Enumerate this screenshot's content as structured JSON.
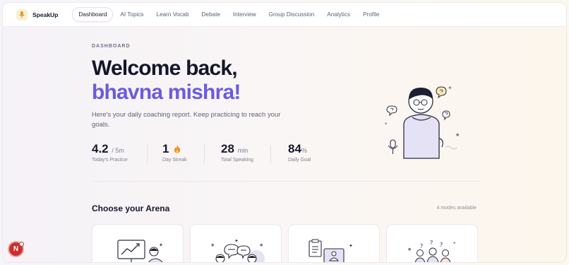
{
  "app": {
    "name": "SpeakUp",
    "accent": "#6a5be2"
  },
  "nav": {
    "items": [
      {
        "label": "Dashboard",
        "active": true
      },
      {
        "label": "AI Topics"
      },
      {
        "label": "Learn Vocab"
      },
      {
        "label": "Debate"
      },
      {
        "label": "Interview"
      },
      {
        "label": "Group Discussion"
      },
      {
        "label": "Analytics"
      },
      {
        "label": "Profile"
      }
    ]
  },
  "hero": {
    "eyebrow": "DASHBOARD",
    "greeting": "Welcome back,",
    "username": "bhavna mishra!",
    "subtitle": "Here's your daily coaching report. Keep practicing to reach your goals."
  },
  "stats": [
    {
      "value": "4.2",
      "unit": "/ 5m",
      "label": "Today's Practice"
    },
    {
      "value": "1",
      "unit": "",
      "label": "Day Streak",
      "icon": "fire-icon"
    },
    {
      "value": "28",
      "unit": "min",
      "label": "Total Speaking"
    },
    {
      "value": "84",
      "unit": "%",
      "label": "Daily Goal"
    }
  ],
  "arena": {
    "title": "Choose your Arena",
    "count": "4 modes available",
    "cards": [
      {
        "icon": "chart-board-icon"
      },
      {
        "icon": "debate-bubbles-icon"
      },
      {
        "icon": "interview-laptop-icon"
      },
      {
        "icon": "group-discussion-icon"
      }
    ]
  },
  "user_avatar": {
    "initial": "N",
    "color": "#c7302f"
  }
}
